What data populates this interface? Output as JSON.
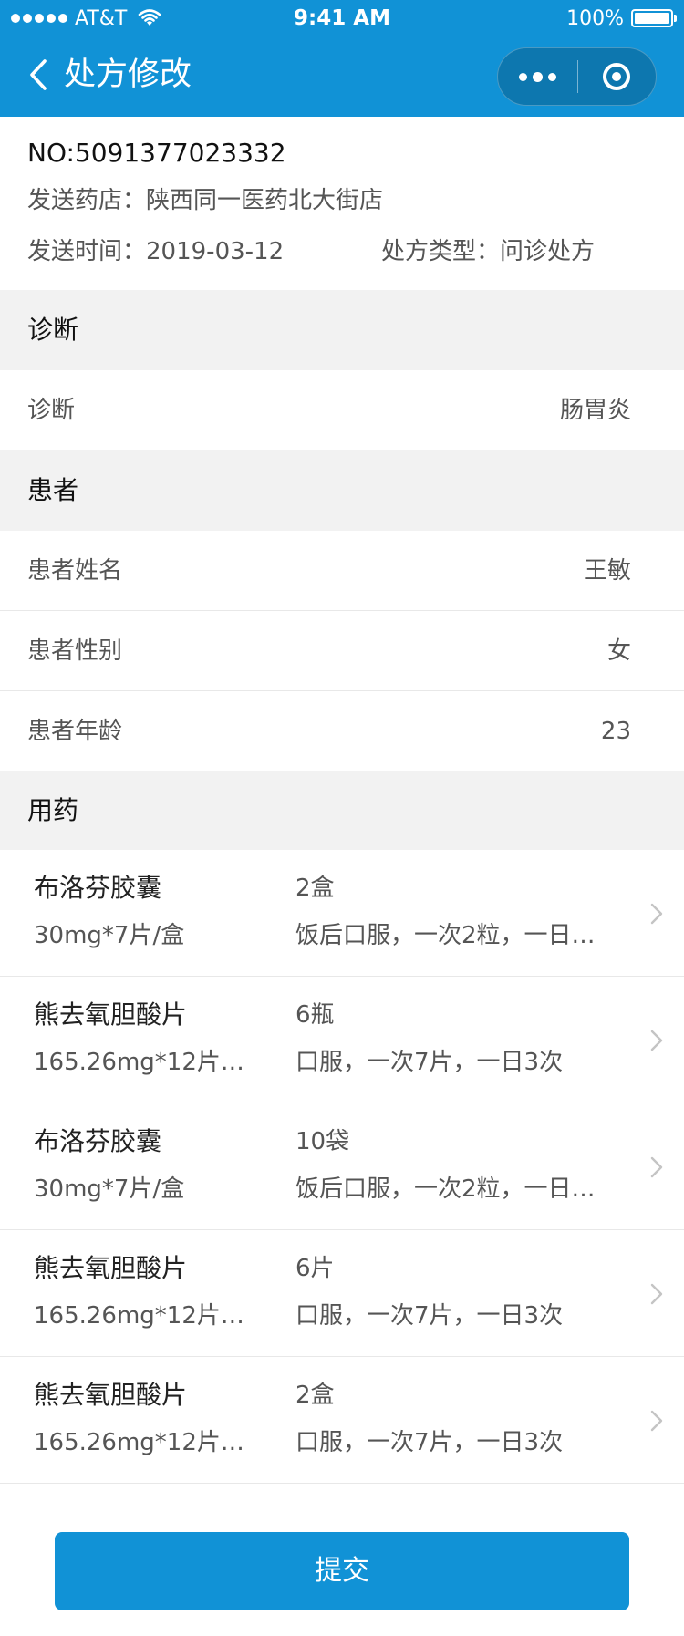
{
  "status_bar": {
    "carrier": "AT&T",
    "time": "9:41 AM",
    "battery": "100%"
  },
  "nav": {
    "title": "处方修改",
    "back_icon": "chevron-left-icon",
    "more_icon": "more-dots-icon",
    "close_icon": "target-circle-icon"
  },
  "prescription": {
    "no": "NO:5091377023332",
    "pharmacy_label": "发送药店：",
    "pharmacy_value": "陕西同一医药北大街店",
    "time_label": "发送时间：",
    "time_value": "2019-03-12",
    "type_label": "处方类型：",
    "type_value": "问诊处方"
  },
  "sections": {
    "diagnosis": "诊断",
    "patient": "患者",
    "medication": "用药"
  },
  "diagnosis": {
    "label": "诊断",
    "value": "肠胃炎"
  },
  "patient": {
    "name_label": "患者姓名",
    "name_value": "王敏",
    "gender_label": "患者性别",
    "gender_value": "女",
    "age_label": "患者年龄",
    "age_value": "23"
  },
  "medicines": [
    {
      "name": "布洛芬胶囊",
      "spec": "30mg*7片/盒",
      "qty": "2盒",
      "usage": "饭后口服，一次2粒，一日…"
    },
    {
      "name": "熊去氧胆酸片",
      "spec": "165.26mg*12片…",
      "qty": "6瓶",
      "usage": "口服，一次7片，一日3次"
    },
    {
      "name": "布洛芬胶囊",
      "spec": "30mg*7片/盒",
      "qty": "10袋",
      "usage": "饭后口服，一次2粒，一日…"
    },
    {
      "name": "熊去氧胆酸片",
      "spec": "165.26mg*12片…",
      "qty": "6片",
      "usage": "口服，一次7片，一日3次"
    },
    {
      "name": "熊去氧胆酸片",
      "spec": "165.26mg*12片…",
      "qty": "2盒",
      "usage": "口服，一次7片，一日3次"
    }
  ],
  "submit_label": "提交",
  "colors": {
    "primary": "#1192d6",
    "section_bg": "#f2f2f2",
    "text_secondary": "#555555"
  }
}
